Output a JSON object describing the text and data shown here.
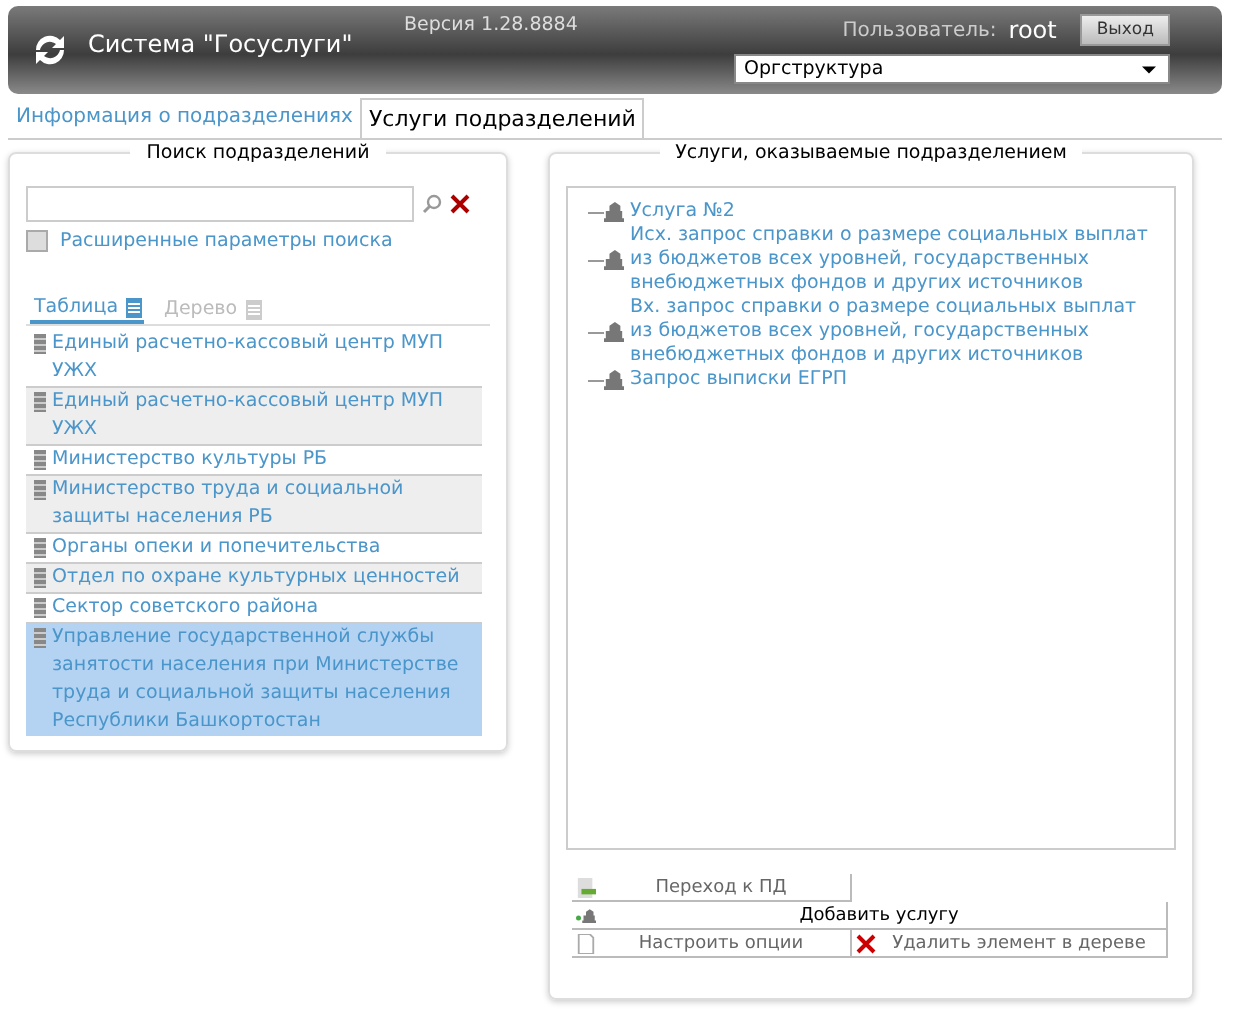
{
  "header": {
    "title": "Система \"Госуслуги\"",
    "version": "Версия 1.28.8884",
    "user_label": "Пользователь:",
    "user": "root",
    "logout": "Выход",
    "section_select": {
      "value": "Оргструктура"
    }
  },
  "tabs": [
    {
      "label": "Информация о подразделениях",
      "selected": false
    },
    {
      "label": "Услуги подразделений",
      "selected": true
    }
  ],
  "search_panel": {
    "title": "Поиск подразделений",
    "advanced": {
      "label": "Расширенные параметры поиска",
      "checked": false
    },
    "view_tabs": [
      {
        "label": "Таблица",
        "selected": true
      },
      {
        "label": "Дерево",
        "selected": false
      }
    ],
    "items": [
      {
        "label": "Единый расчетно-кассовый центр МУП УЖХ",
        "selected": false
      },
      {
        "label": "Единый расчетно-кассовый центр МУП УЖХ",
        "selected": false
      },
      {
        "label": "Министерство культуры РБ",
        "selected": false
      },
      {
        "label": "Министерство труда и социальной защиты населения РБ",
        "selected": false
      },
      {
        "label": "Органы опеки и попечительства",
        "selected": false
      },
      {
        "label": "Отдел по охране культурных ценностей",
        "selected": false
      },
      {
        "label": "Сектор советского района",
        "selected": false
      },
      {
        "label": "Управление государственной службы занятости населения при Министерстве труда и социальной защиты населения Республики Башкортостан",
        "selected": true
      }
    ]
  },
  "services_panel": {
    "title": "Услуги, оказываемые подразделением",
    "services": [
      {
        "label": "Услуга №2"
      },
      {
        "label": "Исх. запрос справки о размере социальных выплат из бюджетов всех уровней, государственных внебюджетных фондов и других источников"
      },
      {
        "label": "Вх. запрос справки о размере социальных выплат из бюджетов всех уровней, государственных внебюджетных фондов и других источников"
      },
      {
        "label": "Запрос выписки ЕГРП"
      }
    ],
    "buttons": {
      "goto": "Переход к ПД",
      "add": "Добавить услугу",
      "options": "Настроить опции",
      "delete": "Удалить элемент в дереве"
    }
  }
}
